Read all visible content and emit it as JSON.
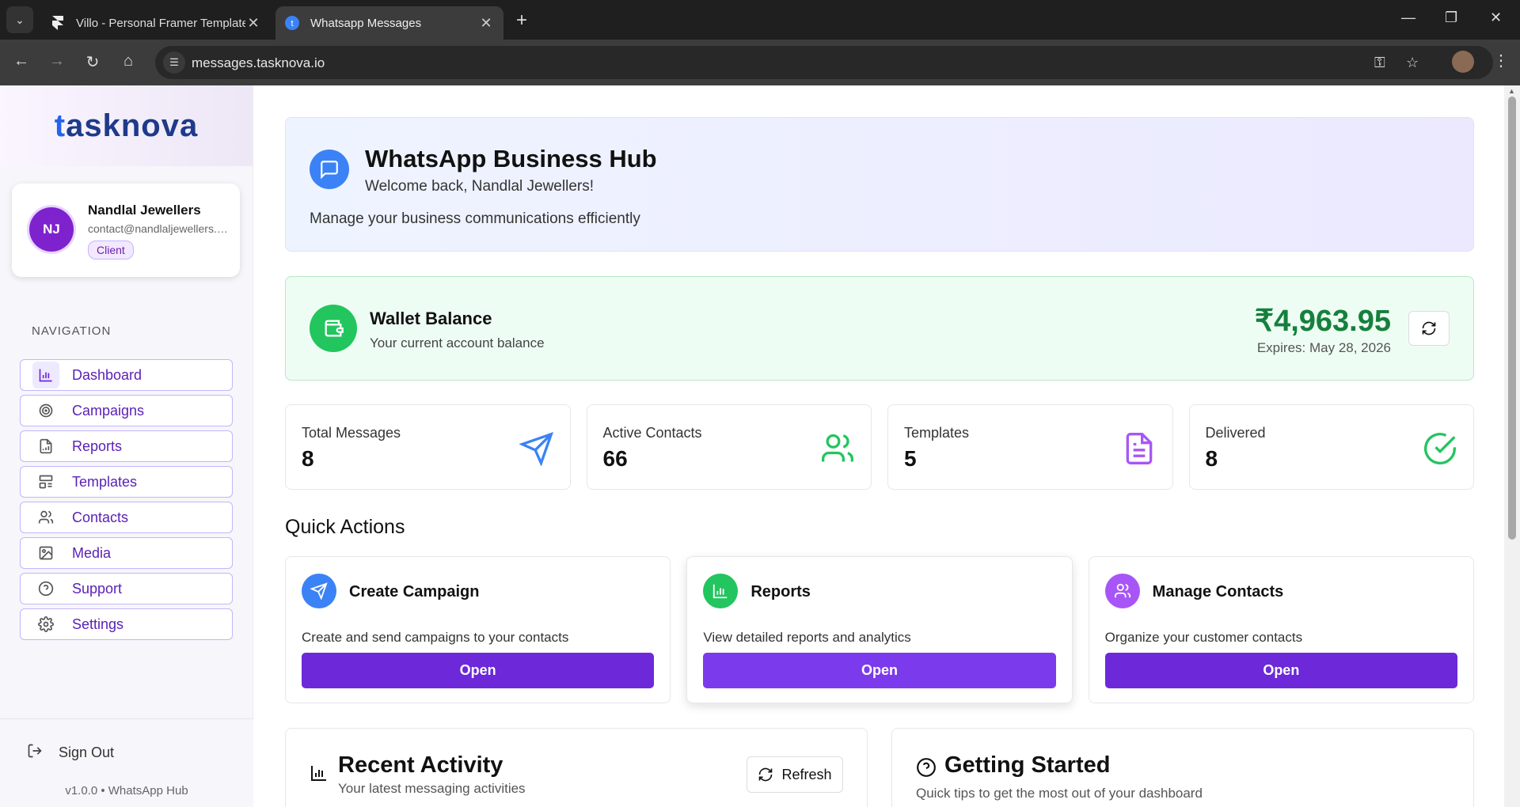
{
  "browser": {
    "tabs": [
      {
        "title": "Villo - Personal Framer Template",
        "active": false
      },
      {
        "title": "Whatsapp Messages",
        "active": true
      }
    ],
    "url": "messages.tasknova.io"
  },
  "sidebar": {
    "logo": {
      "first": "t",
      "rest": "asknova"
    },
    "user": {
      "initials": "NJ",
      "name": "Nandlal Jewellers",
      "email": "contact@nandlaljewellers.com",
      "role": "Client"
    },
    "nav_heading": "NAVIGATION",
    "items": [
      {
        "label": "Dashboard",
        "icon": "bar-chart-icon",
        "active": true
      },
      {
        "label": "Campaigns",
        "icon": "target-icon"
      },
      {
        "label": "Reports",
        "icon": "file-chart-icon"
      },
      {
        "label": "Templates",
        "icon": "layout-icon"
      },
      {
        "label": "Contacts",
        "icon": "users-icon"
      },
      {
        "label": "Media",
        "icon": "image-icon"
      },
      {
        "label": "Support",
        "icon": "help-circle-icon"
      },
      {
        "label": "Settings",
        "icon": "gear-icon"
      }
    ],
    "sign_out": "Sign Out",
    "version": "v1.0.0 • WhatsApp Hub"
  },
  "hero": {
    "title": "WhatsApp Business Hub",
    "subtitle": "Welcome back, Nandlal Jewellers!",
    "description": "Manage your business communications efficiently"
  },
  "wallet": {
    "title": "Wallet Balance",
    "subtitle": "Your current account balance",
    "amount": "₹4,963.95",
    "expires": "Expires: May 28, 2026"
  },
  "stats": [
    {
      "label": "Total Messages",
      "value": "8",
      "icon": "send-icon",
      "color": "#3b82f6"
    },
    {
      "label": "Active Contacts",
      "value": "66",
      "icon": "users-icon",
      "color": "#22c55e"
    },
    {
      "label": "Templates",
      "value": "5",
      "icon": "file-text-icon",
      "color": "#a855f7"
    },
    {
      "label": "Delivered",
      "value": "8",
      "icon": "check-circle-icon",
      "color": "#22c55e"
    }
  ],
  "quick_actions": {
    "title": "Quick Actions",
    "items": [
      {
        "name": "Create Campaign",
        "description": "Create and send campaigns to your contacts",
        "button": "Open",
        "color": "#3b82f6"
      },
      {
        "name": "Reports",
        "description": "View detailed reports and analytics",
        "button": "Open",
        "color": "#22c55e"
      },
      {
        "name": "Manage Contacts",
        "description": "Organize your customer contacts",
        "button": "Open",
        "color": "#a855f7"
      }
    ]
  },
  "recent_activity": {
    "title": "Recent Activity",
    "subtitle": "Your latest messaging activities",
    "refresh": "Refresh"
  },
  "getting_started": {
    "title": "Getting Started",
    "subtitle": "Quick tips to get the most out of your dashboard"
  }
}
